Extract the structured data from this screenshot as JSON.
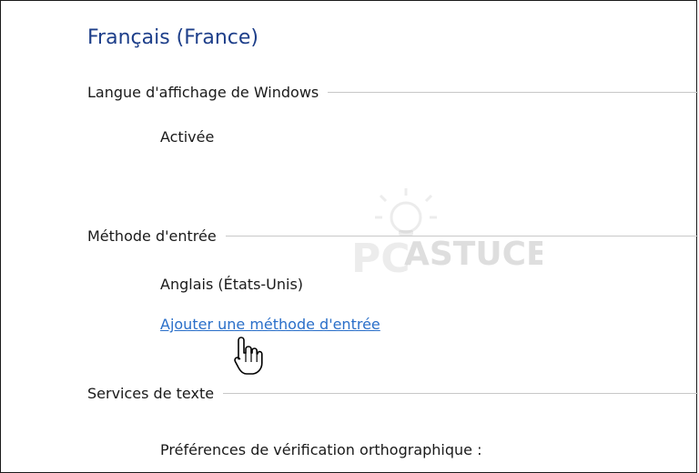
{
  "language": {
    "title": "Français (France)"
  },
  "display_language": {
    "header": "Langue d'affichage de Windows",
    "status": "Activée"
  },
  "input_method": {
    "header": "Méthode d'entrée",
    "current": "Anglais (États-Unis)",
    "add_link": "Ajouter une méthode d'entrée"
  },
  "text_services": {
    "header": "Services de texte",
    "spelling_prefs": "Préférences de vérification orthographique :"
  },
  "watermark": {
    "text": "ASTUCES"
  },
  "colors": {
    "title": "#1e3f8a",
    "link": "#2a6fc9",
    "rule": "#c8c8c8"
  }
}
